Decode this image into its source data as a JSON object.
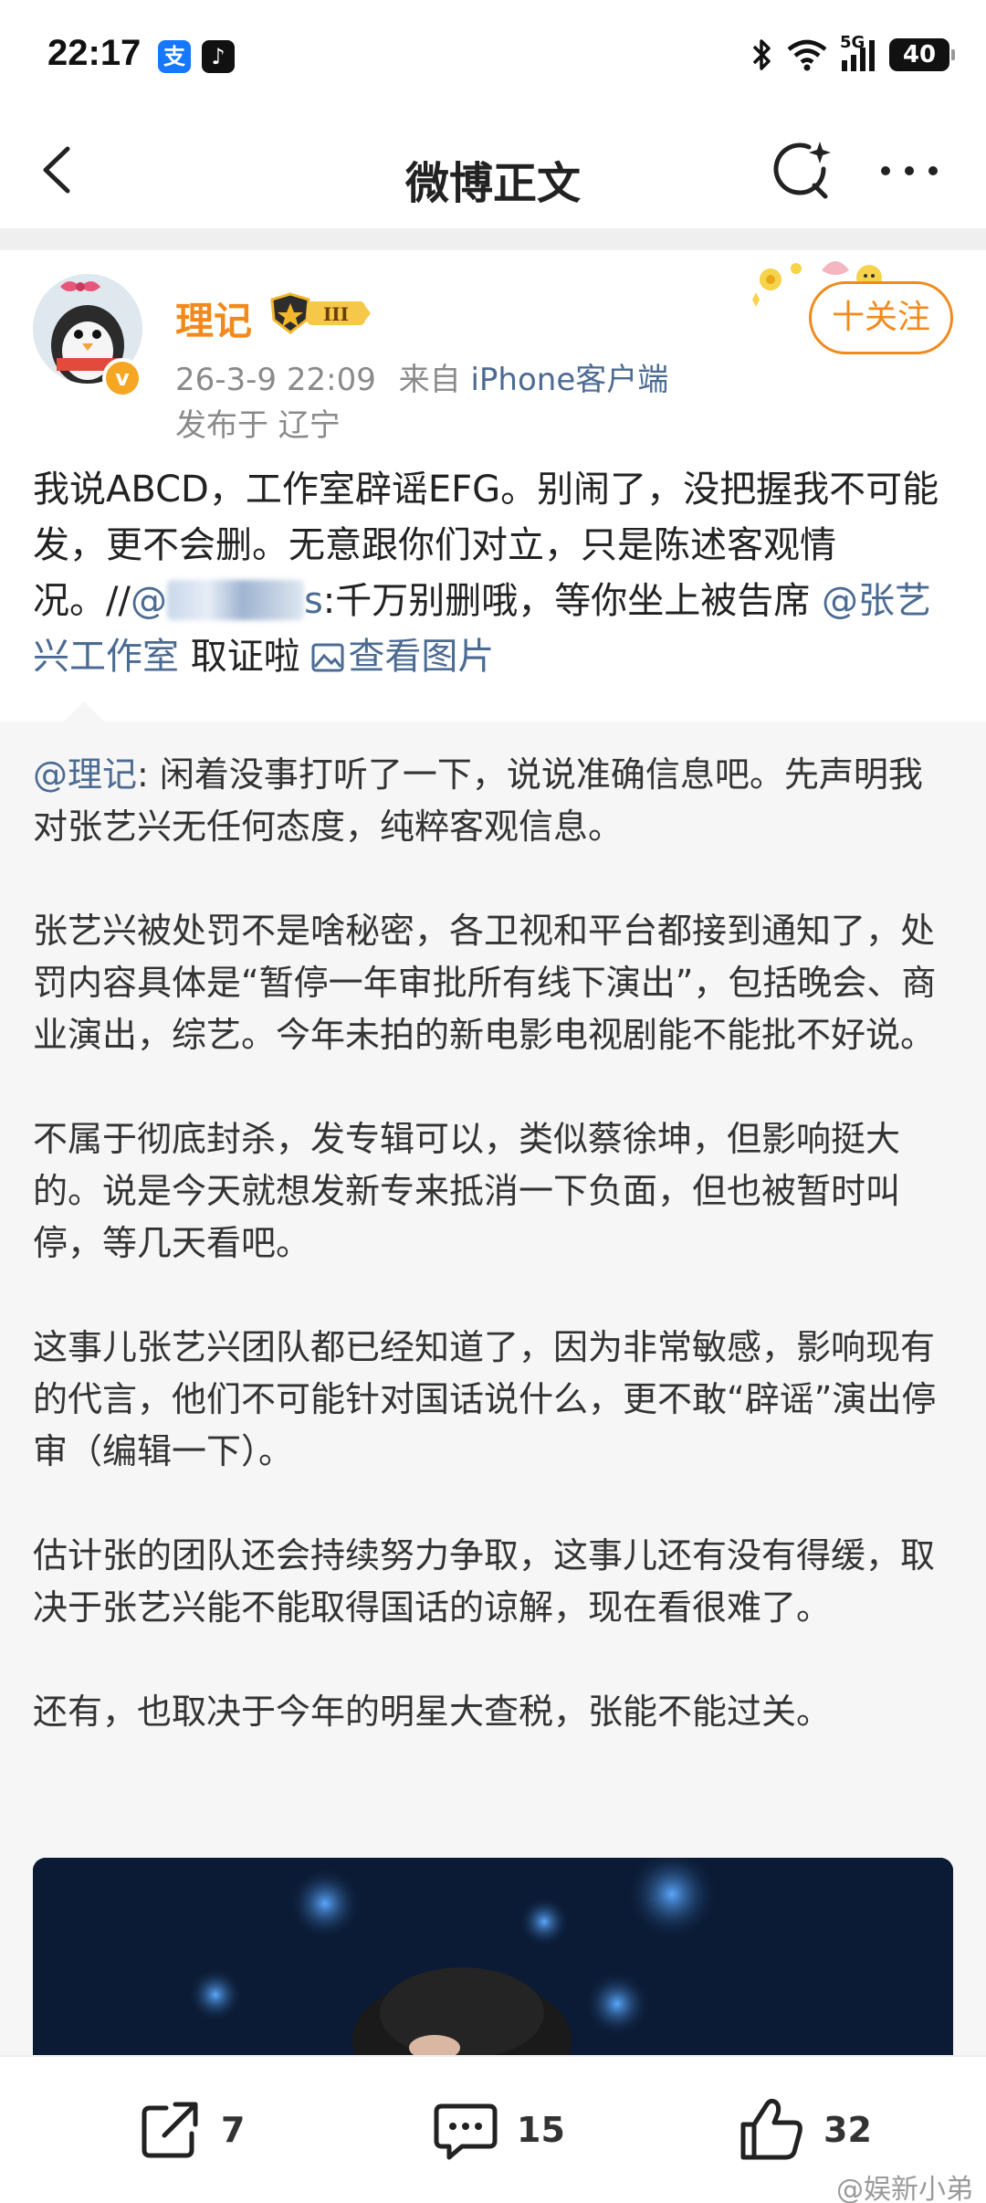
{
  "status_bar": {
    "time": "22:17",
    "alipay_glyph": "支",
    "douyin_glyph": "♪",
    "network": "5G",
    "battery": "40",
    "icons": [
      "bluetooth-icon",
      "wifi-icon",
      "signal-icon",
      "battery-icon"
    ]
  },
  "nav": {
    "title": "微博正文",
    "icons": [
      "back-icon",
      "search-sparkle-icon",
      "more-icon"
    ]
  },
  "post": {
    "username": "理记",
    "vip_level": "III",
    "timestamp": "26-3-9 22:09",
    "from_label": "来自",
    "source": "iPhone客户端",
    "location": "发布于 辽宁",
    "follow_label": "十关注",
    "text_part1": "我说ABCD，工作室辟谣EFG。别闹了，没把握我不可能发，更不会删。无意跟你们对立，只是陈述客观情况。//",
    "mention_blurred_prefix": "@",
    "mention_blurred_suffix": "s",
    "text_part2": ":千万别删哦，等你坐上被告席",
    "mention_studio": "@张艺兴工作室",
    "text_part3": " 取证啦 ",
    "view_image_label": "查看图片"
  },
  "repost": {
    "author": "@理记",
    "paragraph1": ": 闲着没事打听了一下，说说准确信息吧。先声明我对张艺兴无任何态度，纯粹客观信息。",
    "paragraph2": "张艺兴被处罚不是啥秘密，各卫视和平台都接到通知了，处罚内容具体是“暂停一年审批所有线下演出”，包括晚会、商业演出，综艺。今年未拍的新电影电视剧能不能批不好说。",
    "paragraph3": "不属于彻底封杀，发专辑可以，类似蔡徐坤，但影响挺大的。说是今天就想发新专来抵消一下负面，但也被暂时叫停，等几天看吧。",
    "paragraph4": "这事儿张艺兴团队都已经知道了，因为非常敏感，影响现有的代言，他们不可能针对国话说什么，更不敢“辟谣”演出停审（编辑一下）。",
    "paragraph5": "估计张的团队还会持续努力争取，这事儿还有没有得缓，取决于张艺兴能不能取得国话的谅解，现在看很难了。",
    "paragraph6": "还有，也取决于今年的明星大查税，张能不能过关。"
  },
  "toolbar": {
    "share_count": "7",
    "comment_count": "15",
    "like_count": "32"
  },
  "watermark": "@娱新小弟",
  "colors": {
    "accent_orange": "#f28a1b",
    "link_blue": "#4b6b93",
    "repost_bg": "#f6f6f6"
  }
}
